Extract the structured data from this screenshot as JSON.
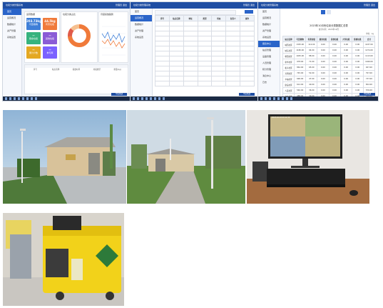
{
  "screens": {
    "s1": {
      "title": "垃圾分类管理系统",
      "user": "管理员 退出",
      "nav": [
        "首页",
        "运营概况",
        "数据统计",
        "资产管理",
        "系统设置"
      ],
      "panel_titles": [
        "运营数据",
        "垃圾分类占比",
        "月度投放趋势"
      ],
      "tiles": [
        {
          "value": "203.73kg",
          "label": "可回收物",
          "color": "#3f7fd8"
        },
        {
          "value": "44.5kg",
          "label": "有害垃圾",
          "color": "#f07a3a"
        },
        {
          "value": "--",
          "label": "厨余垃圾",
          "color": "#36b37e"
        },
        {
          "value": "--",
          "label": "其他垃圾",
          "color": "#8a5bd6"
        },
        {
          "value": "--",
          "label": "累计户数",
          "color": "#e4a822"
        },
        {
          "value": "--",
          "label": "参与率",
          "color": "#7b61ff"
        }
      ],
      "table_headers": [
        "序号",
        "站点名称",
        "投放时间",
        "垃圾类型",
        "重量(kg)"
      ],
      "footer": "中铁城建"
    },
    "s2": {
      "title": "垃圾分类管理系统",
      "user": "管理员 退出",
      "nav": [
        "首页",
        "运营概况",
        "数据统计",
        "资产管理",
        "系统设置"
      ],
      "headers": [
        "序号",
        "站点名称",
        "地址",
        "类型",
        "状态",
        "负责人",
        "操作"
      ],
      "footer": "中铁城建"
    },
    "s3": {
      "title": "垃圾分类管理系统",
      "user": "管理员 退出",
      "nav": [
        "首页",
        "运营概况",
        "数据统计",
        "资产管理",
        "系统设置",
        "报表中心",
        "站点管理",
        "设备管理",
        "人员管理",
        "积分管理",
        "消息中心",
        "日志"
      ],
      "report_title": "2023年10月份垃圾分类数据汇总表",
      "report_sub": "统计时间：2023年10月",
      "unit": "单位：kg",
      "headers": [
        "站点名称",
        "可回收物",
        "有害垃圾",
        "厨余垃圾",
        "其他垃圾",
        "大件垃圾",
        "装修垃圾",
        "合计"
      ],
      "rows": [
        [
          "城西社区",
          "1325.00",
          "112.00",
          "0.00",
          "0.00",
          "0.00",
          "0.00",
          "1437.00"
        ],
        [
          "城东社区",
          "1180.00",
          "94.00",
          "0.00",
          "0.00",
          "0.00",
          "0.00",
          "1274.00"
        ],
        [
          "朝阳社区",
          "1025.00",
          "88.00",
          "0.00",
          "0.00",
          "0.00",
          "0.00",
          "1113.00"
        ],
        [
          "新华社区",
          "978.00",
          "71.00",
          "0.00",
          "0.00",
          "0.00",
          "0.00",
          "1049.00"
        ],
        [
          "和平社区",
          "862.00",
          "65.00",
          "0.00",
          "0.00",
          "0.00",
          "0.00",
          "927.00"
        ],
        [
          "光明社区",
          "745.00",
          "52.00",
          "0.00",
          "0.00",
          "0.00",
          "0.00",
          "797.00"
        ],
        [
          "幸福社区",
          "690.00",
          "47.00",
          "0.00",
          "0.00",
          "0.00",
          "0.00",
          "737.00"
        ],
        [
          "建设社区",
          "612.00",
          "40.00",
          "0.00",
          "0.00",
          "0.00",
          "0.00",
          "652.00"
        ],
        [
          "人民社区",
          "540.00",
          "36.00",
          "0.00",
          "0.00",
          "0.00",
          "0.00",
          "576.00"
        ],
        [
          "文化社区",
          "488.00",
          "30.00",
          "0.00",
          "0.00",
          "0.00",
          "0.00",
          "518.00"
        ],
        [
          "合计",
          "8445.00",
          "635.00",
          "0.00",
          "0.00",
          "0.00",
          "0.00",
          "9080.00"
        ]
      ],
      "footer": "中铁城建"
    }
  },
  "photos": [
    {
      "name": "collection-station-exterior"
    },
    {
      "name": "station-walkway"
    },
    {
      "name": "monitoring-screen"
    },
    {
      "name": "hazardous-waste-carts"
    }
  ],
  "monitor_osd": "2023-10-18 09:12:30",
  "colors": {
    "brand": "#1f4ea3",
    "accent": "#2a64c9"
  }
}
